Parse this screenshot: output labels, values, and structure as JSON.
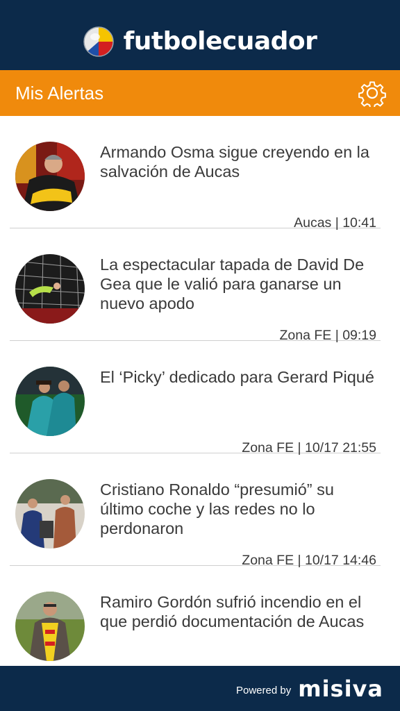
{
  "header": {
    "brand": "futbolecuador",
    "logo_icon": "soccer-ball-logo-icon"
  },
  "titlebar": {
    "title": "Mis Alertas",
    "settings_icon": "gear-icon"
  },
  "alerts": [
    {
      "headline": "Armando Osma sigue creyendo en la salvación de Aucas",
      "meta": "Aucas | 10:41"
    },
    {
      "headline": "La espectacular tapada de David De Gea que le valió para ganarse un nuevo apodo",
      "meta": "Zona FE | 09:19"
    },
    {
      "headline": "El ‘Picky’ dedicado para Gerard Piqué",
      "meta": "Zona FE | 10/17 21:55"
    },
    {
      "headline": "Cristiano Ronaldo “presumió” su último coche y las redes no lo perdonaron",
      "meta": "Zona FE | 10/17 14:46"
    },
    {
      "headline": "Ramiro Gordón sufrió incendio en el que perdió documentación de Aucas",
      "meta": ""
    }
  ],
  "footer": {
    "powered_by": "Powered by",
    "brand": "misiva"
  },
  "colors": {
    "header_bg": "#0c2a4a",
    "accent": "#f08a0c",
    "text": "#3a3a3a",
    "divider": "#cfcfcf"
  }
}
